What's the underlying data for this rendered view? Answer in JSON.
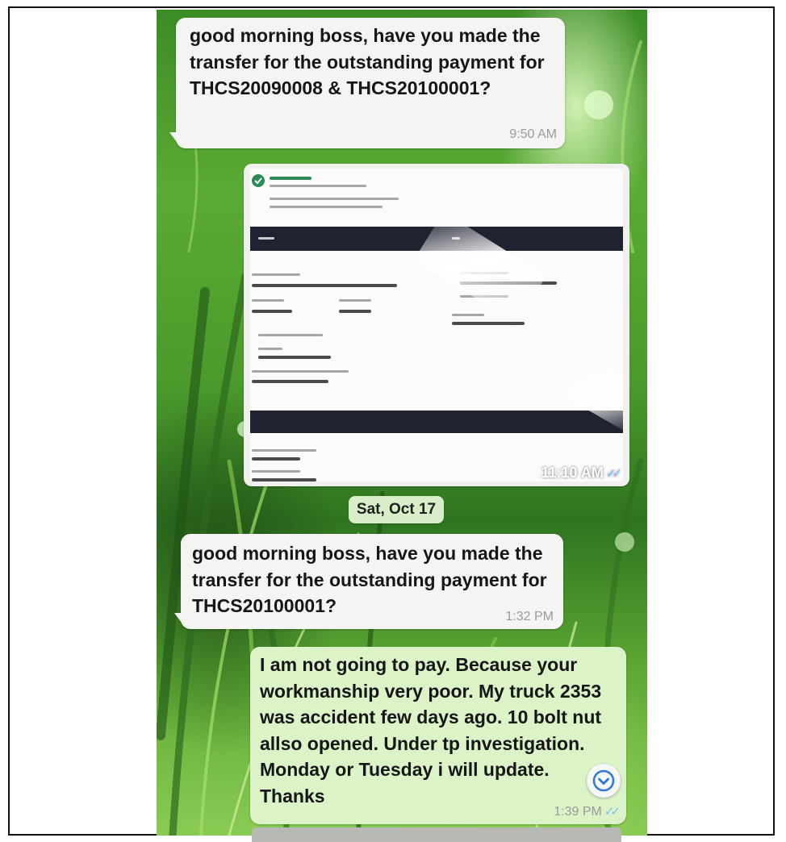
{
  "messages": [
    {
      "direction": "incoming",
      "text": "good morning boss, have you made the transfer for the outstanding payment for THCS20090008 & THCS20100001?",
      "time": "9:50 AM"
    },
    {
      "direction": "outgoing",
      "type": "image",
      "description": "bank transfer receipt screenshot",
      "time": "11:10 AM",
      "status": "read"
    },
    {
      "direction": "incoming",
      "text": "good morning boss, have you made the transfer for the outstanding payment for THCS20100001?",
      "time": "1:32 PM"
    },
    {
      "direction": "outgoing",
      "text": "I am not going to pay. Because your workmanship very poor. My truck 2353 was accident few days ago. 10 bolt nut allso opened. Under tp investigation. Monday or Tuesday i will update. Thanks",
      "time": "1:39 PM",
      "status": "read"
    }
  ],
  "date_separator": "Sat, Oct 17",
  "icons": {
    "scroll_down": "chevron-down-circle-icon",
    "read_receipt": "double-check-icon"
  },
  "colors": {
    "incoming_bubble": "#f4f5f2",
    "outgoing_bubble": "#dcf3c8",
    "read_ticks": "#7cc0ff",
    "wallpaper_green": "#4b9a2c"
  }
}
